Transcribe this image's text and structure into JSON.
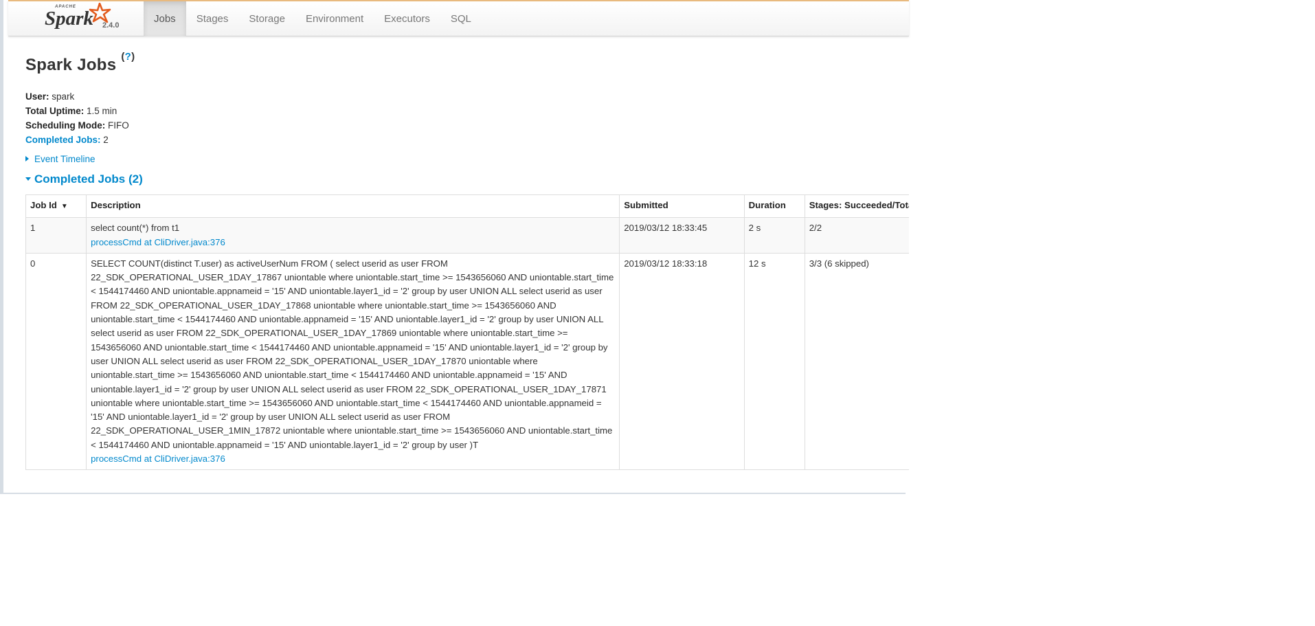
{
  "brand": {
    "apache": "APACHE",
    "name": "Spark",
    "version": "2.4.0",
    "star_color": "#e25a1c"
  },
  "nav": {
    "tabs": [
      {
        "label": "Jobs",
        "active": true
      },
      {
        "label": "Stages",
        "active": false
      },
      {
        "label": "Storage",
        "active": false
      },
      {
        "label": "Environment",
        "active": false
      },
      {
        "label": "Executors",
        "active": false
      },
      {
        "label": "SQL",
        "active": false
      }
    ]
  },
  "page": {
    "title": "Spark Jobs",
    "help_open": "(",
    "help_mark": "?",
    "help_close": ")"
  },
  "summary": {
    "user_label": "User:",
    "user_value": "spark",
    "uptime_label": "Total Uptime:",
    "uptime_value": "1.5 min",
    "mode_label": "Scheduling Mode:",
    "mode_value": "FIFO",
    "completed_label": "Completed Jobs:",
    "completed_value": "2"
  },
  "timeline": {
    "label": "Event Timeline"
  },
  "completed_section": {
    "label": "Completed Jobs (2)"
  },
  "table": {
    "headers": {
      "job_id": "Job Id",
      "sort_arrow": "▼",
      "description": "Description",
      "submitted": "Submitted",
      "duration": "Duration",
      "stages": "Stages: Succeeded/Total"
    },
    "rows": [
      {
        "job_id": "1",
        "description": "select count(*) from t1",
        "link": "processCmd at CliDriver.java:376",
        "submitted": "2019/03/12 18:33:45",
        "duration": "2 s",
        "stages": "2/2"
      },
      {
        "job_id": "0",
        "description": "SELECT COUNT(distinct T.user) as activeUserNum FROM ( select userid as user FROM 22_SDK_OPERATIONAL_USER_1DAY_17867 uniontable where uniontable.start_time >= 1543656060 AND uniontable.start_time < 1544174460 AND uniontable.appnameid = '15' AND uniontable.layer1_id = '2' group by user UNION ALL select userid as user FROM 22_SDK_OPERATIONAL_USER_1DAY_17868 uniontable where uniontable.start_time >= 1543656060 AND uniontable.start_time < 1544174460 AND uniontable.appnameid = '15' AND uniontable.layer1_id = '2' group by user UNION ALL select userid as user FROM 22_SDK_OPERATIONAL_USER_1DAY_17869 uniontable where uniontable.start_time >= 1543656060 AND uniontable.start_time < 1544174460 AND uniontable.appnameid = '15' AND uniontable.layer1_id = '2' group by user UNION ALL select userid as user FROM 22_SDK_OPERATIONAL_USER_1DAY_17870 uniontable where uniontable.start_time >= 1543656060 AND uniontable.start_time < 1544174460 AND uniontable.appnameid = '15' AND uniontable.layer1_id = '2' group by user UNION ALL select userid as user FROM 22_SDK_OPERATIONAL_USER_1DAY_17871 uniontable where uniontable.start_time >= 1543656060 AND uniontable.start_time < 1544174460 AND uniontable.appnameid = '15' AND uniontable.layer1_id = '2' group by user UNION ALL select userid as user FROM 22_SDK_OPERATIONAL_USER_1MIN_17872 uniontable where uniontable.start_time >= 1543656060 AND uniontable.start_time < 1544174460 AND uniontable.appnameid = '15' AND uniontable.layer1_id = '2' group by user )T",
        "link": "processCmd at CliDriver.java:376",
        "submitted": "2019/03/12 18:33:18",
        "duration": "12 s",
        "stages": "3/3 (6 skipped)"
      }
    ]
  },
  "colors": {
    "link": "#0088cc",
    "navbar_top_border": "#e8b97e"
  }
}
